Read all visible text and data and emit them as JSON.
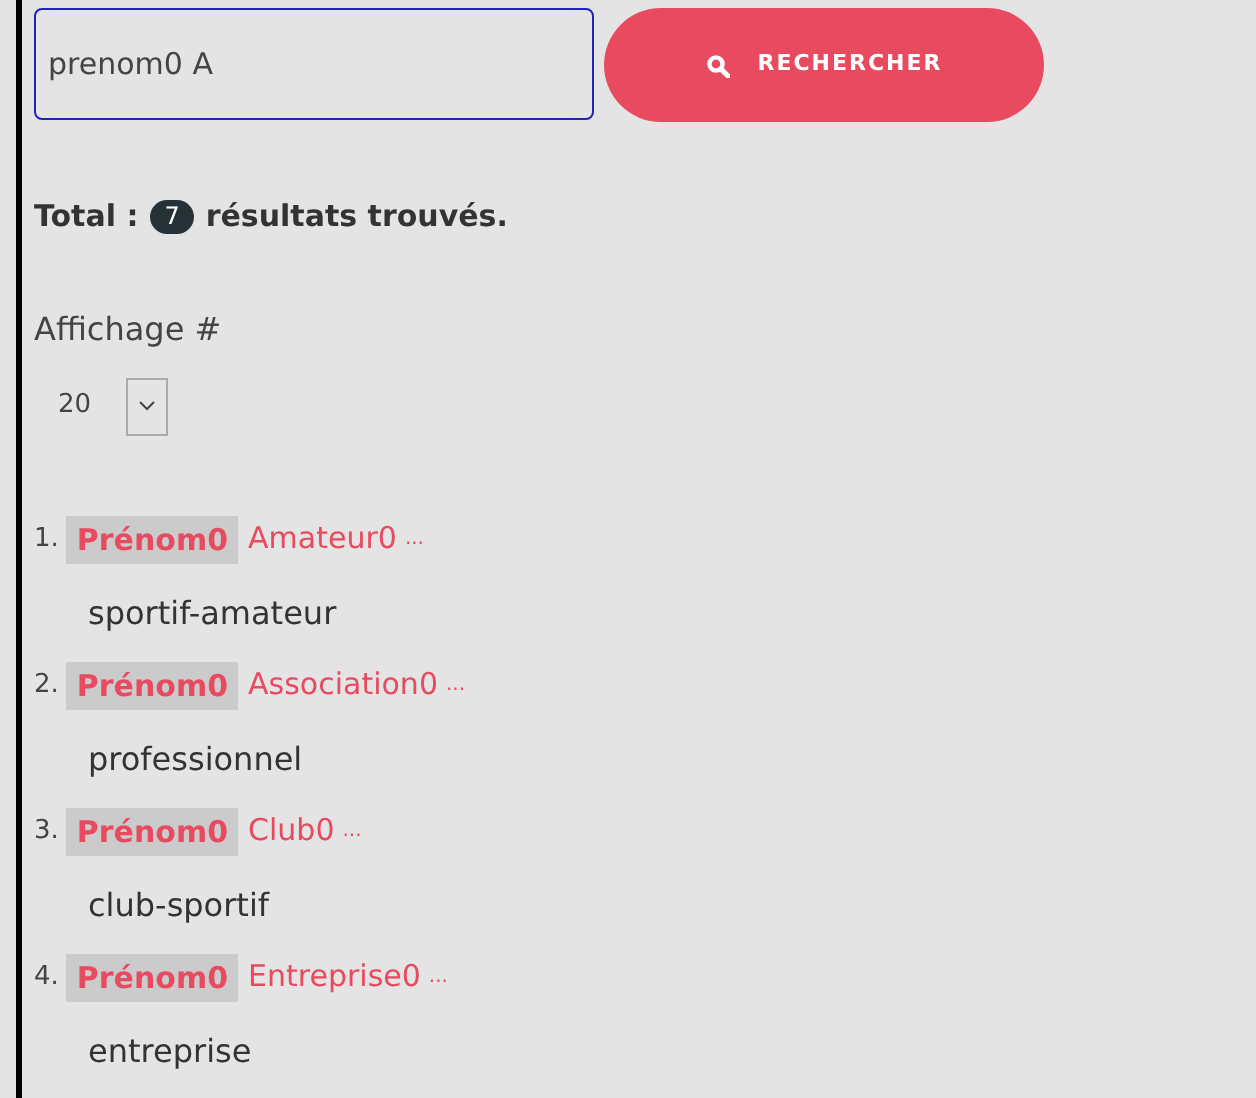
{
  "search": {
    "value": "prenom0 A",
    "button": "RECHERCHER"
  },
  "total": {
    "label": "Total :",
    "count": "7",
    "suffix": "résultats trouvés."
  },
  "display": {
    "label": "Affichage #",
    "value": "20"
  },
  "results": [
    {
      "number": "1.",
      "tag": "Prénom0",
      "name": "Amateur0",
      "ellipsis": "...",
      "category": "sportif-amateur"
    },
    {
      "number": "2.",
      "tag": "Prénom0",
      "name": "Association0",
      "ellipsis": "...",
      "category": "professionnel"
    },
    {
      "number": "3.",
      "tag": "Prénom0",
      "name": "Club0",
      "ellipsis": "...",
      "category": "club-sportif"
    },
    {
      "number": "4.",
      "tag": "Prénom0",
      "name": "Entreprise0",
      "ellipsis": "...",
      "category": "entreprise"
    }
  ]
}
